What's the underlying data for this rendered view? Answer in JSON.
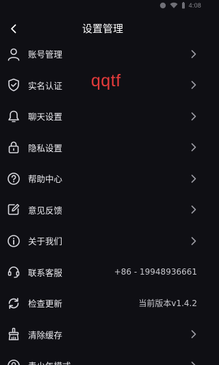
{
  "status_bar": {
    "time": "4:08"
  },
  "header": {
    "title": "设置管理"
  },
  "watermark": "qqtf",
  "rows": [
    {
      "label": "账号管理",
      "icon": "person-icon"
    },
    {
      "label": "实名认证",
      "icon": "shield-check-icon"
    },
    {
      "label": "聊天设置",
      "icon": "bell-icon"
    },
    {
      "label": "隐私设置",
      "icon": "lock-icon"
    },
    {
      "label": "帮助中心",
      "icon": "help-circle-icon"
    },
    {
      "label": "意见反馈",
      "icon": "edit-note-icon"
    },
    {
      "label": "关于我们",
      "icon": "info-circle-icon"
    },
    {
      "label": "联系客服",
      "icon": "headset-icon",
      "value": "+86 - 19948936661"
    },
    {
      "label": "检查更新",
      "icon": "refresh-icon",
      "value": "当前版本v1.4.2"
    },
    {
      "label": "清除缓存",
      "icon": "broom-icon"
    },
    {
      "label": "青少年模式",
      "icon": "teen-mode-icon"
    }
  ],
  "colors": {
    "background": "#0f0f14",
    "text": "#eeeef2",
    "icon": "#d8d8de",
    "chevron": "#9a9aa2",
    "watermark": "#e23b3b"
  }
}
